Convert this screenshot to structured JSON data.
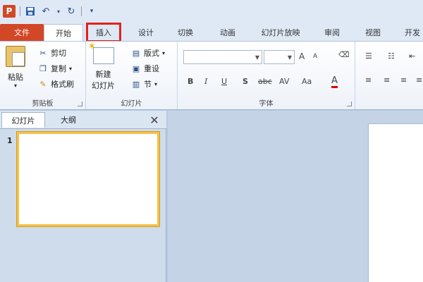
{
  "app": {
    "icon_letter": "P"
  },
  "qat": {
    "save_icon": "save-icon",
    "undo_icon": "undo-icon",
    "redo_icon": "redo-icon",
    "customize_icon": "customize-icon"
  },
  "tabs": {
    "file": "文件",
    "home": "开始",
    "insert": "插入",
    "design": "设计",
    "transitions": "切换",
    "animations": "动画",
    "slideshow": "幻灯片放映",
    "review": "审阅",
    "view": "视图",
    "developer": "开发"
  },
  "ribbon": {
    "clipboard": {
      "paste": "粘贴",
      "cut": "剪切",
      "copy": "复制",
      "format_painter": "格式刷",
      "label": "剪贴板"
    },
    "slides": {
      "new_slide_line1": "新建",
      "new_slide_line2": "幻灯片",
      "layout": "版式",
      "reset": "重设",
      "section": "节",
      "label": "幻灯片"
    },
    "font": {
      "label": "字体",
      "bold": "B",
      "italic": "I",
      "underline": "U",
      "shadow": "S",
      "strike": "abc",
      "spacing": "AV",
      "case": "Aa",
      "color": "A",
      "grow": "A",
      "shrink": "A"
    },
    "paragraph": {}
  },
  "panel": {
    "tab_slides": "幻灯片",
    "tab_outline": "大纲",
    "close": "✕",
    "slide_number": "1"
  }
}
